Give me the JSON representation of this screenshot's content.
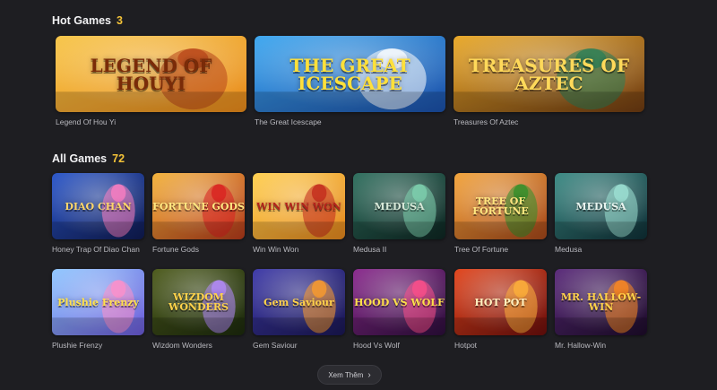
{
  "hot": {
    "title": "Hot Games",
    "count": "3",
    "games": [
      {
        "name": "Legend Of Hou Yi",
        "logo": "LEGEND OF HOUYI",
        "icon": "archer-hero-art",
        "bg1": "#f7c64a",
        "bg2": "#e88a1b",
        "accent": "#b8461a",
        "logo_color": "#7a2b08"
      },
      {
        "name": "The Great Icescape",
        "logo": "THE GREAT ICESCAPE",
        "icon": "penguin-art",
        "bg1": "#3fa8f0",
        "bg2": "#1b4fa8",
        "accent": "#ffffff",
        "logo_color": "#ffe03a"
      },
      {
        "name": "Treasures Of Aztec",
        "logo": "TREASURES OF AZTEC",
        "icon": "aztec-queen-art",
        "bg1": "#e9a92a",
        "bg2": "#6d3a12",
        "accent": "#2a7f57",
        "logo_color": "#ffd95a"
      }
    ]
  },
  "all": {
    "title": "All Games",
    "count": "72",
    "games": [
      {
        "name": "Honey Trap Of Diao Chan",
        "logo": "DIAO CHAN",
        "icon": "diao-chan-art",
        "bg1": "#2a56c9",
        "bg2": "#101b52",
        "accent": "#ff7fc2",
        "logo_color": "#ffd76a"
      },
      {
        "name": "Fortune Gods",
        "logo": "FORTUNE GODS",
        "icon": "fortune-gods-art",
        "bg1": "#f3b23a",
        "bg2": "#b3391b",
        "accent": "#d91f1f",
        "logo_color": "#ffe680"
      },
      {
        "name": "Win Win Won",
        "logo": "WIN WIN WON",
        "icon": "shiba-dog-art",
        "bg1": "#ffcf4f",
        "bg2": "#e3861d",
        "accent": "#c1271b",
        "logo_color": "#b3231b"
      },
      {
        "name": "Medusa II",
        "logo": "MEDUSA",
        "icon": "medusa-art",
        "bg1": "#2f6f5e",
        "bg2": "#0e2622",
        "accent": "#7fd3b0",
        "logo_color": "#d7e8d8"
      },
      {
        "name": "Tree Of Fortune",
        "logo": "TREE OF FORTUNE",
        "icon": "fortune-tree-art",
        "bg1": "#f2a33a",
        "bg2": "#a3461a",
        "accent": "#2f8f2a",
        "logo_color": "#ffe680"
      },
      {
        "name": "Medusa",
        "logo": "MEDUSA",
        "icon": "medusa-art",
        "bg1": "#3b8a84",
        "bg2": "#0f2f36",
        "accent": "#9fe3d5",
        "logo_color": "#e9f4ef"
      },
      {
        "name": "Plushie Frenzy",
        "logo": "Plushie Frenzy",
        "icon": "plush-toy-art",
        "bg1": "#8fc7ff",
        "bg2": "#6b5ad9",
        "accent": "#ff8fc8",
        "logo_color": "#ffe14a"
      },
      {
        "name": "Wizdom Wonders",
        "logo": "WIZDOM WONDERS",
        "icon": "wizard-art",
        "bg1": "#4d5b1c",
        "bg2": "#1c2a0d",
        "accent": "#b58bff",
        "logo_color": "#ffd24a"
      },
      {
        "name": "Gem Saviour",
        "logo": "Gem Saviour",
        "icon": "gem-hero-art",
        "bg1": "#3e3aa8",
        "bg2": "#1a1753",
        "accent": "#ff9d2a",
        "logo_color": "#ffd24a"
      },
      {
        "name": "Hood Vs Wolf",
        "logo": "HOOD VS WOLF",
        "icon": "wolf-art",
        "bg1": "#8a2a8d",
        "bg2": "#2c0e3b",
        "accent": "#ff4f8a",
        "logo_color": "#ffe14a"
      },
      {
        "name": "Hotpot",
        "logo": "HOT POT",
        "icon": "hotpot-art",
        "bg1": "#e2451c",
        "bg2": "#6a0e0c",
        "accent": "#ffb33a",
        "logo_color": "#fff1c0"
      },
      {
        "name": "Mr. Hallow-Win",
        "logo": "MR. HALLOW-WIN",
        "icon": "pumpkin-art",
        "bg1": "#5a2a7a",
        "bg2": "#1d0c2a",
        "accent": "#ff8a1f",
        "logo_color": "#ffd24a"
      }
    ]
  },
  "more_button": {
    "label": "Xem Thêm",
    "icon": "chevron-right-icon"
  }
}
